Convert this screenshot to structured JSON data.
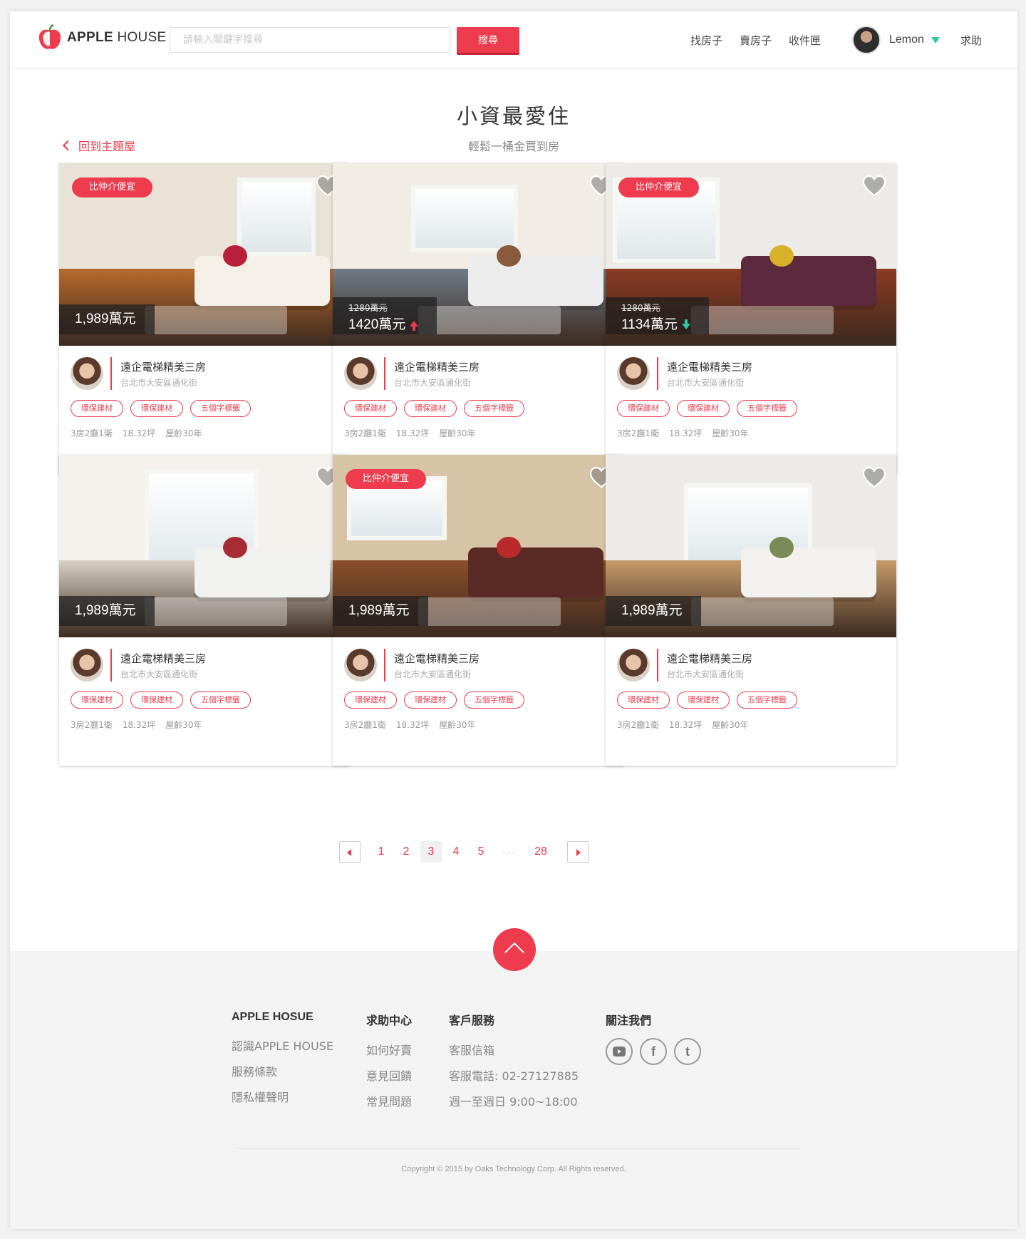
{
  "header": {
    "logo_text_bold": "APPLE",
    "logo_text_light": "HOUSE",
    "search_placeholder": "請輸入關鍵字搜尋",
    "search_button": "搜尋",
    "nav": [
      "找房子",
      "賣房子",
      "收件匣"
    ],
    "user_name": "Lemon",
    "help": "求助"
  },
  "page": {
    "title": "小資最愛住",
    "subtitle": "輕鬆一桶金買到房",
    "back_link": "回到主題屋"
  },
  "listings": [
    {
      "badge": "比仲介便宜",
      "old_price": "",
      "price": "1,989萬元",
      "trend": "",
      "title": "遠企電梯精美三房",
      "address": "台北市大安區通化街",
      "tags": [
        "環保建材",
        "環保建材",
        "五個字標籤"
      ],
      "specs": [
        "3房2廳1衛",
        "18.32坪",
        "屋齡30年"
      ]
    },
    {
      "badge": "",
      "old_price": "1280萬元",
      "price": "1420萬元",
      "trend": "up",
      "title": "遠企電梯精美三房",
      "address": "台北市大安區通化街",
      "tags": [
        "環保建材",
        "環保建材",
        "五個字標籤"
      ],
      "specs": [
        "3房2廳1衛",
        "18.32坪",
        "屋齡30年"
      ]
    },
    {
      "badge": "比仲介便宜",
      "old_price": "1280萬元",
      "price": "1134萬元",
      "trend": "down",
      "title": "遠企電梯精美三房",
      "address": "台北市大安區通化街",
      "tags": [
        "環保建材",
        "環保建材",
        "五個字標籤"
      ],
      "specs": [
        "3房2廳1衛",
        "18.32坪",
        "屋齡30年"
      ]
    },
    {
      "badge": "",
      "old_price": "",
      "price": "1,989萬元",
      "trend": "",
      "title": "遠企電梯精美三房",
      "address": "台北市大安區通化街",
      "tags": [
        "環保建材",
        "環保建材",
        "五個字標籤"
      ],
      "specs": [
        "3房2廳1衛",
        "18.32坪",
        "屋齡30年"
      ]
    },
    {
      "badge": "比仲介便宜",
      "old_price": "",
      "price": "1,989萬元",
      "trend": "",
      "title": "遠企電梯精美三房",
      "address": "台北市大安區通化街",
      "tags": [
        "環保建材",
        "環保建材",
        "五個字標籤"
      ],
      "specs": [
        "3房2廳1衛",
        "18.32坪",
        "屋齡30年"
      ]
    },
    {
      "badge": "",
      "old_price": "",
      "price": "1,989萬元",
      "trend": "",
      "title": "遠企電梯精美三房",
      "address": "台北市大安區通化街",
      "tags": [
        "環保建材",
        "環保建材",
        "五個字標籤"
      ],
      "specs": [
        "3房2廳1衛",
        "18.32坪",
        "屋齡30年"
      ]
    }
  ],
  "pagination": {
    "pages": [
      "1",
      "2",
      "3",
      "4",
      "5"
    ],
    "current": "3",
    "ellipsis": "···",
    "last": "28"
  },
  "footer": {
    "columns": [
      {
        "heading": "APPLE HOSUE",
        "links": [
          "認識APPLE HOUSE",
          "服務條款",
          "隱私權聲明"
        ]
      },
      {
        "heading": "求助中心",
        "links": [
          "如何好賣",
          "意見回饋",
          "常見問題"
        ]
      },
      {
        "heading": "客戶服務",
        "links": [
          "客服信箱",
          "客服電話: 02-27127885",
          "週一至週日 9:00~18:00"
        ]
      }
    ],
    "follow_heading": "關注我們",
    "socials": [
      "youtube-icon",
      "facebook-icon",
      "tumblr-icon"
    ],
    "copyright": "Copyright © 2015 by Oaks Technology Corp. All Rights reserved."
  },
  "colors": {
    "accent": "#ee3b4d",
    "teal": "#2cc9a6"
  }
}
